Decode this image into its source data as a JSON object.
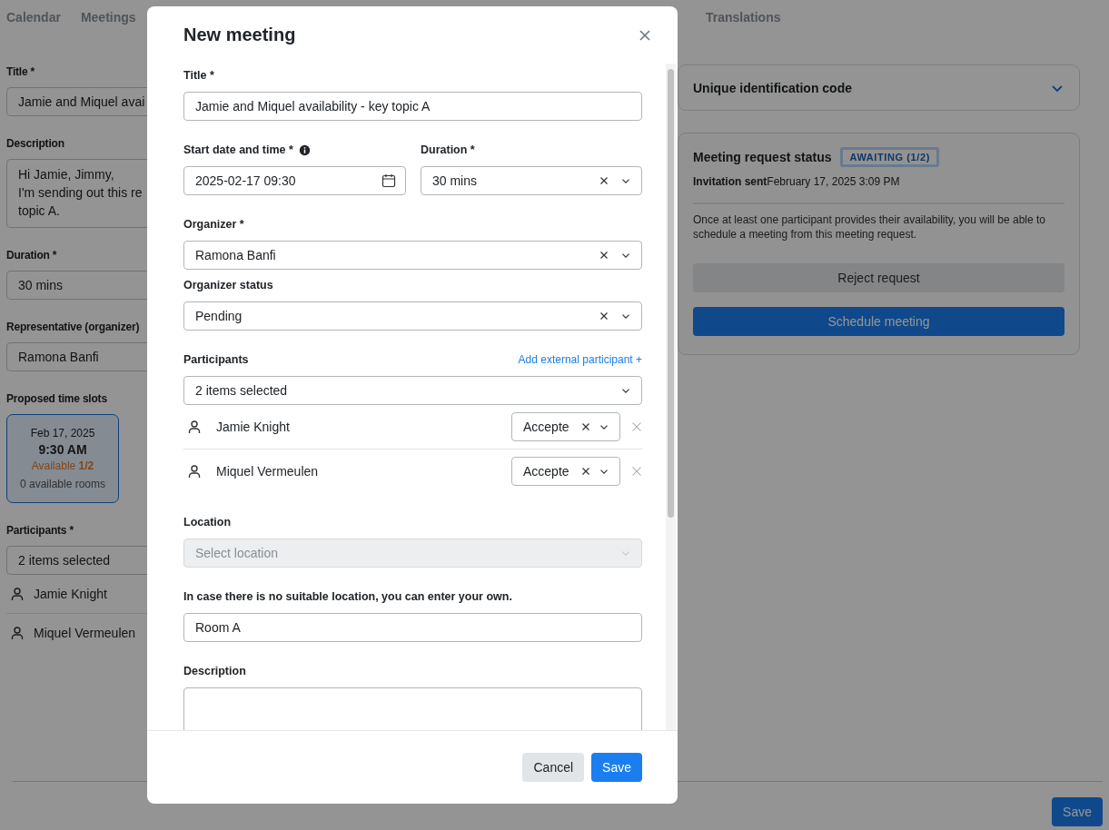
{
  "nav_tabs": [
    {
      "label": "Calendar"
    },
    {
      "label": "Meetings"
    },
    {
      "label": "Translations"
    }
  ],
  "background_form": {
    "title": {
      "label": "Title *",
      "value": "Jamie and Miquel avai"
    },
    "description": {
      "label": "Description",
      "lines": [
        "Hi Jamie, Jimmy,",
        "I'm sending out this re",
        "topic A."
      ]
    },
    "duration": {
      "label": "Duration *",
      "value": "30 mins"
    },
    "representative": {
      "label": "Representative (organizer)",
      "value": "Ramona Banfi"
    },
    "time_slots": {
      "label": "Proposed time slots",
      "slots": [
        {
          "date": "Feb 17, 2025",
          "time": "9:30 AM",
          "availability": "Available **1/2**",
          "rooms": "0 available rooms",
          "selected": true
        }
      ]
    },
    "participants": {
      "label": "Participants *",
      "value": "2 items selected",
      "people": [
        "Jamie Knight",
        "Miquel Vermeulen"
      ]
    }
  },
  "side_panel": {
    "id_code": {
      "title": "Unique identification code",
      "expanded": false
    },
    "status_card": {
      "title": "Meeting request status",
      "badge": "AWAITING (1/2)",
      "sent": "**Invitation sent**February 17, 2025 3:09 PM",
      "note": "Once at least one participant provides their availability, you will be able to schedule a meeting from this meeting request.",
      "buttons": [
        {
          "label": "Reject request",
          "kind": "secondary"
        },
        {
          "label": "Schedule meeting",
          "kind": "primary"
        }
      ]
    }
  },
  "page_save": "Save",
  "modal": {
    "title": "New meeting",
    "fields": [
      {
        "kind": "text",
        "label": "Title *",
        "value": "Jamie and Miquel availability - key topic A"
      },
      {
        "kind": "pair",
        "items": [
          {
            "kind": "date",
            "label": "Start date and time *",
            "info": true,
            "value": "2025-02-17 09:30"
          },
          {
            "kind": "select",
            "label": "Duration *",
            "value": "30 mins",
            "clearable": true,
            "disabled": false
          }
        ]
      },
      {
        "kind": "stack",
        "items": [
          {
            "kind": "select",
            "label": "Organizer *",
            "value": "Ramona Banfi",
            "clearable": true,
            "disabled": false
          },
          {
            "kind": "select",
            "label": "Organizer status",
            "value": "Pending",
            "clearable": true,
            "disabled": false
          }
        ]
      },
      {
        "kind": "participants",
        "label": "Participants",
        "link": "Add external participant +",
        "value": "2 items selected",
        "people": [
          {
            "name": "Jamie Knight",
            "status": "Accepte"
          },
          {
            "name": "Miquel Vermeulen",
            "status": "Accepte"
          }
        ]
      },
      {
        "kind": "select",
        "label": "Location",
        "placeholder": "Select location",
        "clearable": false,
        "disabled": true
      },
      {
        "kind": "text",
        "label": "In case there is no suitable location, you can enter your own.",
        "value": "Room A"
      },
      {
        "kind": "textarea",
        "label": "Description"
      }
    ],
    "buttons": [
      {
        "label": "Cancel",
        "kind": "secondary"
      },
      {
        "label": "Save",
        "kind": "primary"
      }
    ]
  }
}
